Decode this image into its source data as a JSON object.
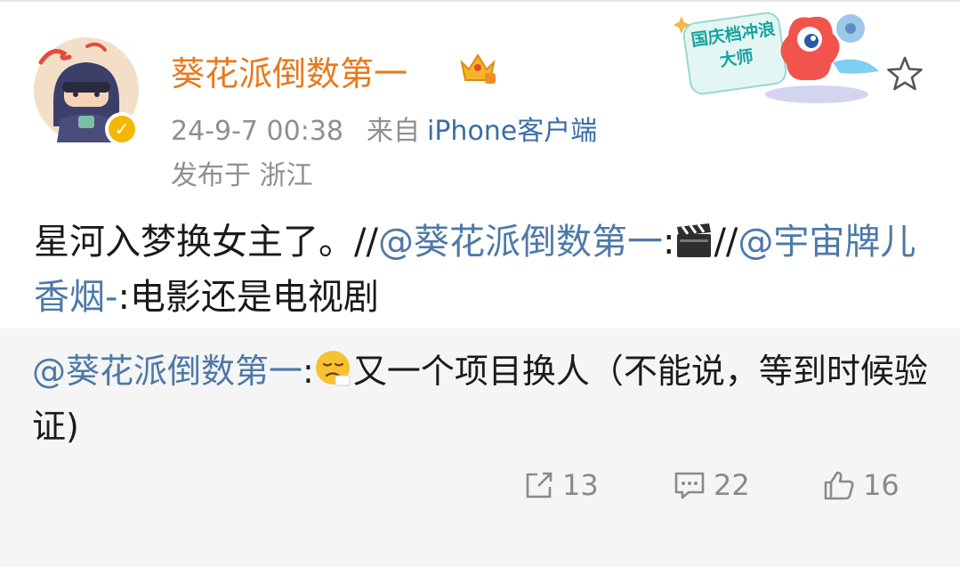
{
  "post": {
    "author": "葵花派倒数第一",
    "time": "24-9-7 00:38",
    "source_prefix": "来自",
    "source": "iPhone客户端",
    "location": "发布于 浙江",
    "campaign_badge": "国庆档冲浪大师",
    "text_main": "星河入梦换女主了。//",
    "mention_1": "@葵花派倒数第一",
    "colon_1": ":",
    "clapper_emoji": "🎬",
    "sep_2": "//",
    "mention_2": "@宇宙牌儿香烟-",
    "text_tail": ":电影还是电视剧"
  },
  "retweet": {
    "mention": "@葵花派倒数第一",
    "colon": ":",
    "emoji": "😔",
    "text": "又一个项目换人（不能说，等到时候验证)"
  },
  "actions": {
    "repost_count": "13",
    "comment_count": "22",
    "like_count": "16"
  },
  "colors": {
    "username": "#e8791c",
    "link": "#4d79a8",
    "meta": "#8f8f8f",
    "retweet_bg": "#f5f5f5",
    "verified": "#f5b800"
  }
}
